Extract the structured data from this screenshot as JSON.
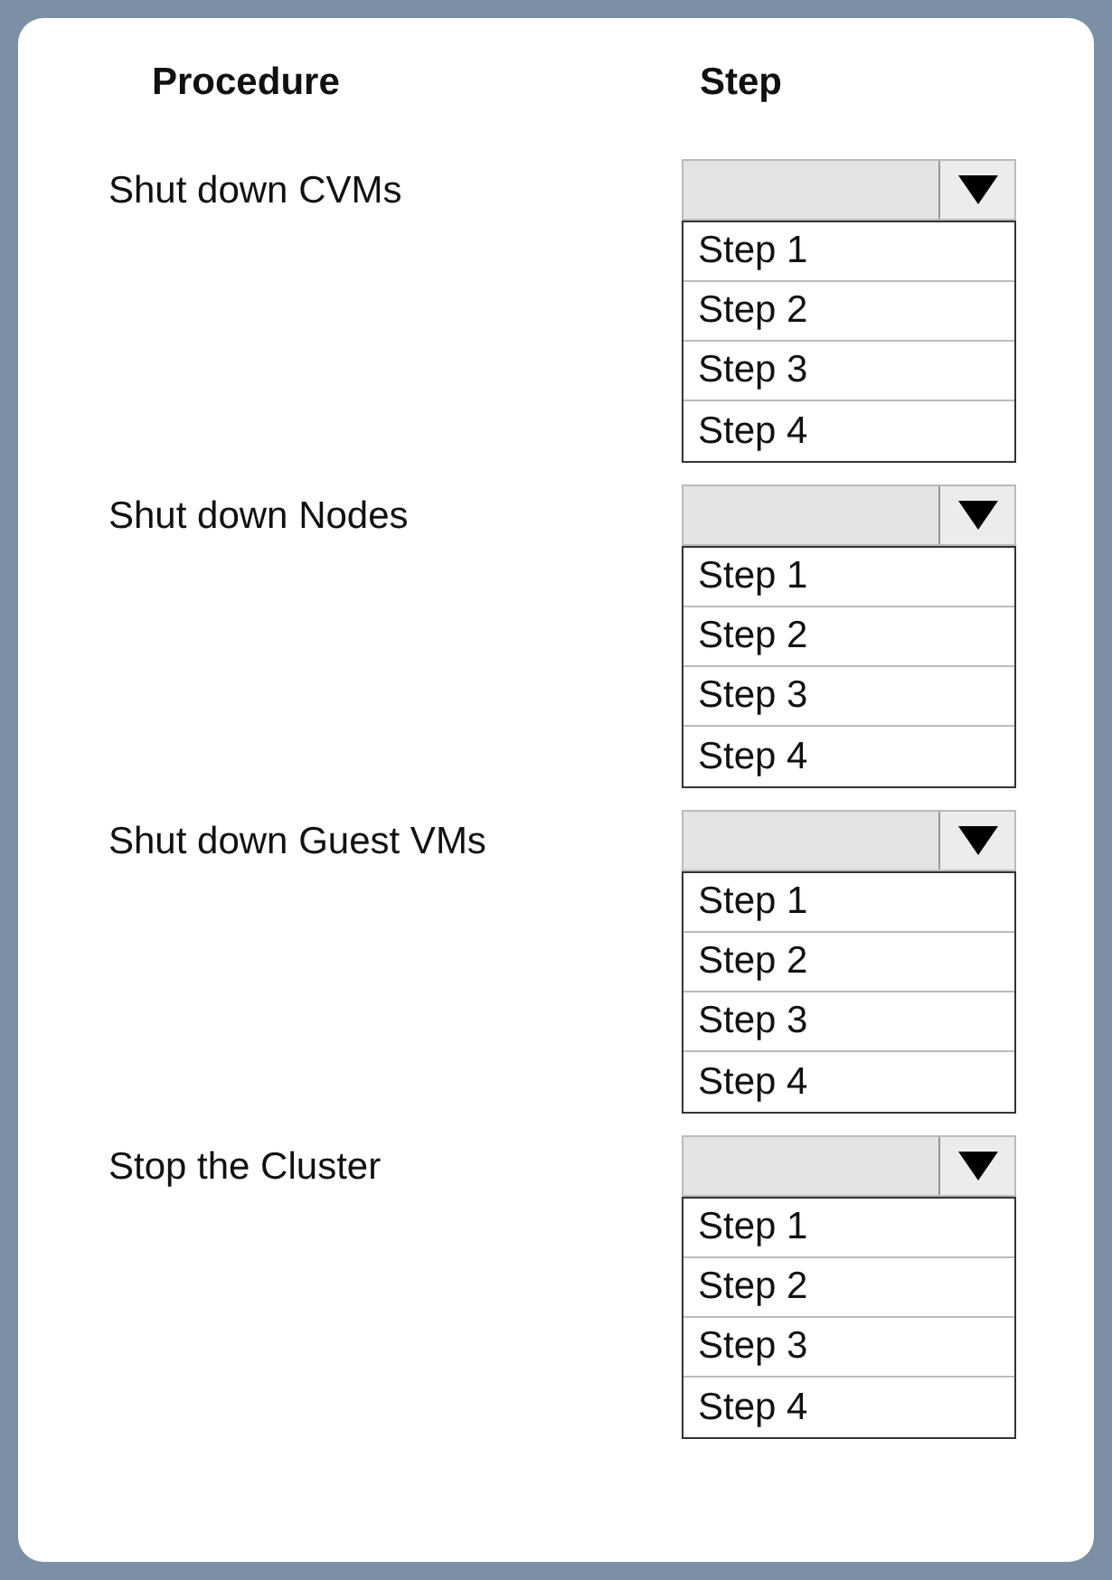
{
  "headers": {
    "procedure": "Procedure",
    "step": "Step"
  },
  "procedures": [
    {
      "label": "Shut  down CVMs",
      "options": [
        "Step 1",
        "Step 2",
        "Step 3",
        "Step 4"
      ]
    },
    {
      "label": "Shut down Nodes",
      "options": [
        "Step 1",
        "Step 2",
        "Step 3",
        "Step 4"
      ]
    },
    {
      "label": "Shut down Guest VMs",
      "options": [
        "Step 1",
        "Step 2",
        "Step 3",
        "Step 4"
      ]
    },
    {
      "label": "Stop the Cluster",
      "options": [
        "Step 1",
        "Step 2",
        "Step 3",
        "Step 4"
      ]
    }
  ]
}
